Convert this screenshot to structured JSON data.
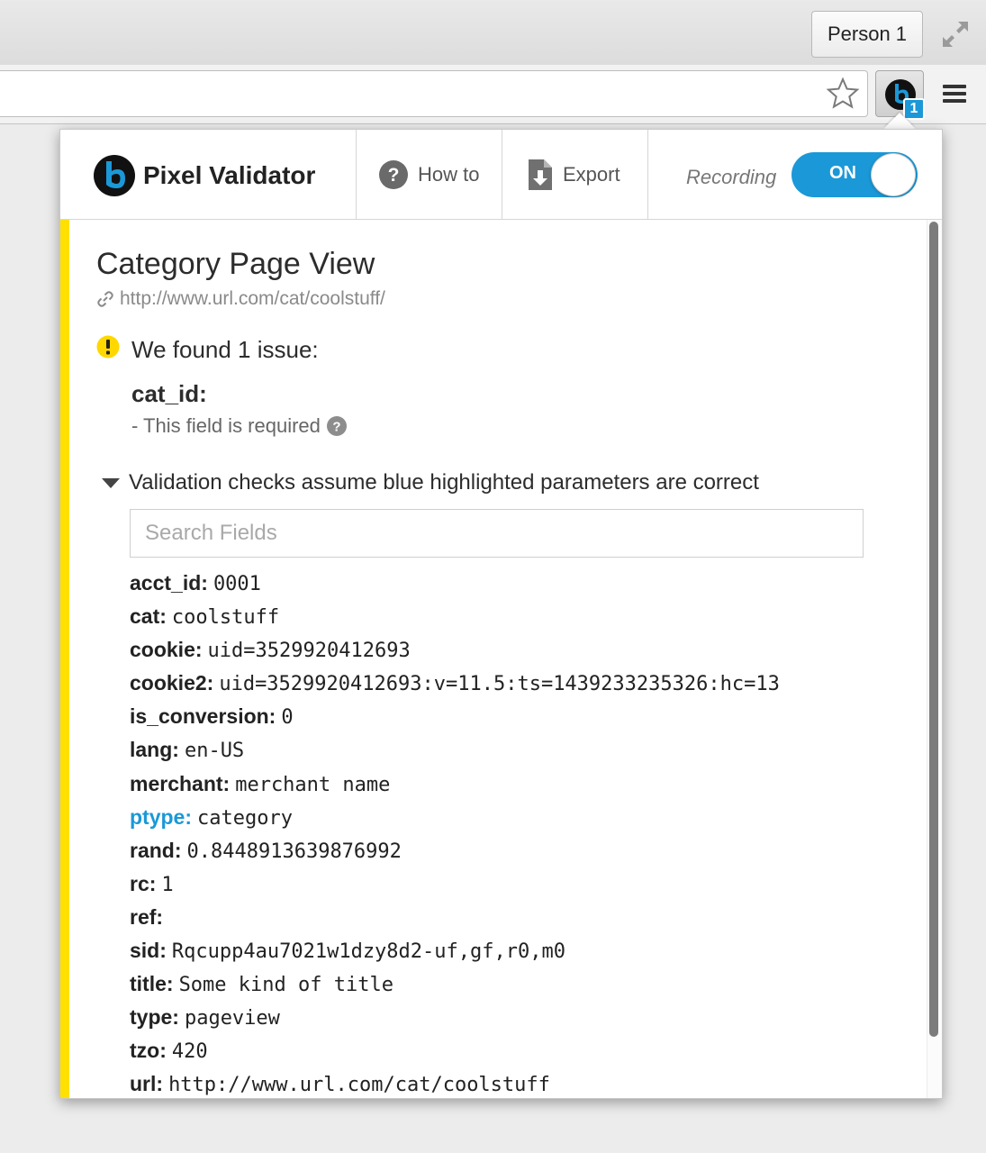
{
  "browser": {
    "profile_label": "Person 1",
    "extension_badge": "1",
    "icons": {
      "fullscreen": "fullscreen-icon",
      "bookmark": "star-icon",
      "menu": "hamburger-menu-icon"
    }
  },
  "header": {
    "brand_name": "Pixel Validator",
    "howto_label": "How to",
    "export_label": "Export",
    "recording_label": "Recording",
    "toggle_label": "ON",
    "toggle_state": "on"
  },
  "event": {
    "title": "Category Page View",
    "url": "http://www.url.com/cat/coolstuff/"
  },
  "issues": {
    "summary": "We found 1 issue:",
    "field": "cat_id:",
    "message": "- This field is required"
  },
  "checks": {
    "note": "Validation checks assume blue highlighted parameters are correct",
    "search_placeholder": "Search Fields"
  },
  "fields": [
    {
      "key": "acct_id:",
      "value": "0001",
      "highlighted": false
    },
    {
      "key": "cat:",
      "value": "coolstuff",
      "highlighted": false
    },
    {
      "key": "cookie:",
      "value": "uid=3529920412693",
      "highlighted": false
    },
    {
      "key": "cookie2:",
      "value": "uid=3529920412693:v=11.5:ts=1439233235326:hc=13",
      "highlighted": false
    },
    {
      "key": "is_conversion:",
      "value": "0",
      "highlighted": false
    },
    {
      "key": "lang:",
      "value": "en-US",
      "highlighted": false
    },
    {
      "key": "merchant:",
      "value": "merchant name",
      "highlighted": false
    },
    {
      "key": "ptype:",
      "value": "category",
      "highlighted": true
    },
    {
      "key": "rand:",
      "value": "0.8448913639876992",
      "highlighted": false
    },
    {
      "key": "rc:",
      "value": "1",
      "highlighted": false
    },
    {
      "key": "ref:",
      "value": "",
      "highlighted": false
    },
    {
      "key": "sid:",
      "value": "Rqcupp4au7021w1dzy8d2-uf,gf,r0,m0",
      "highlighted": false
    },
    {
      "key": "title:",
      "value": "Some kind of title",
      "highlighted": false
    },
    {
      "key": "type:",
      "value": "pageview",
      "highlighted": false
    },
    {
      "key": "tzo:",
      "value": "420",
      "highlighted": false
    },
    {
      "key": "url:",
      "value": "http://www.url.com/cat/coolstuff",
      "highlighted": false
    }
  ],
  "colors": {
    "accent": "#1b98d7",
    "warning": "#ffe000",
    "text": "#222222"
  }
}
